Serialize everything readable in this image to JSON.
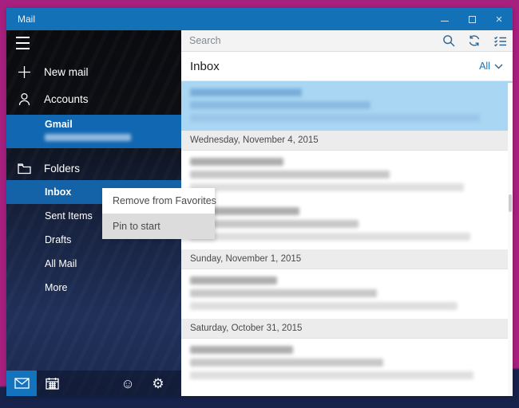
{
  "window": {
    "title": "Mail"
  },
  "sidebar": {
    "new_mail_label": "New mail",
    "accounts_label": "Accounts",
    "account": {
      "name": "Gmail",
      "email_blurred": true
    },
    "folders_label": "Folders",
    "folders": [
      "Inbox",
      "Sent Items",
      "Drafts",
      "All Mail",
      "More"
    ],
    "selected_folder": "Inbox"
  },
  "context_menu": {
    "items": [
      "Remove from Favorites",
      "Pin to start"
    ],
    "highlighted_index": 1
  },
  "search": {
    "placeholder": "Search"
  },
  "list": {
    "title": "Inbox",
    "filter_label": "All",
    "items": [
      {
        "type": "email",
        "selected": true
      },
      {
        "type": "separator",
        "label": "Wednesday, November 4, 2015"
      },
      {
        "type": "email"
      },
      {
        "type": "email"
      },
      {
        "type": "separator",
        "label": "Sunday, November 1, 2015"
      },
      {
        "type": "email"
      },
      {
        "type": "separator",
        "label": "Saturday, October 31, 2015"
      },
      {
        "type": "email"
      }
    ]
  },
  "icons": {
    "hamburger": "three-lines",
    "new_mail": "plus",
    "accounts": "person-outline",
    "folders": "folder-outline",
    "mail_nav": "envelope",
    "calendar_nav": "calendar-grid",
    "feedback": "☺",
    "settings": "⚙",
    "search": "magnifier",
    "sync": "circular-arrows",
    "filter": "checklist",
    "dropdown": "chevron-down",
    "minimize": "–",
    "close": "×"
  },
  "colors": {
    "titlebar_blue": "#1371b8",
    "selected_account_blue": "#1167b1",
    "selected_folder_blue": "#1463a8",
    "selected_email_bg": "#a9d7f3",
    "frame_magenta": "#a8207f",
    "desktop_navy": "#17234b",
    "searchbar_bg": "#f3f3f4",
    "date_separator_bg": "#ececec",
    "menu_highlight_bg": "#dcdcdc"
  }
}
